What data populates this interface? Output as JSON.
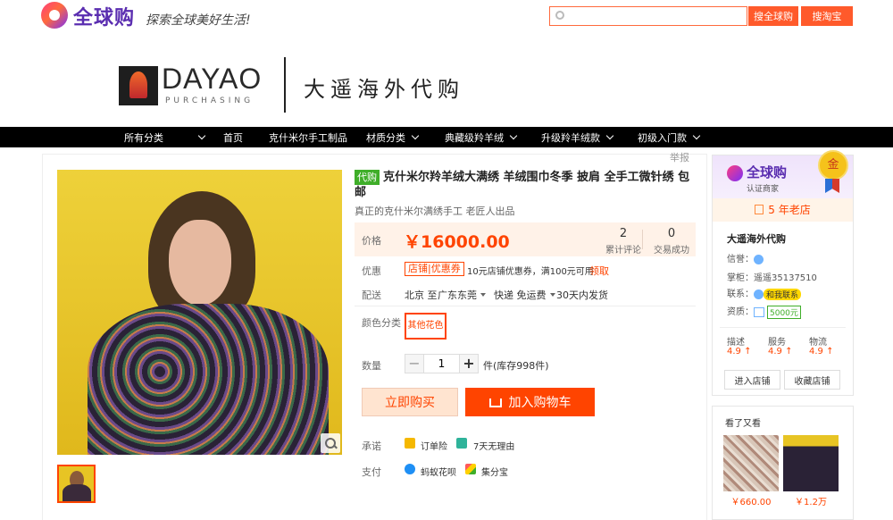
{
  "header": {
    "logo_text": "全球购",
    "slogan": "探索全球美好生活!",
    "search_placeholder": "",
    "search_global_label": "搜全球购",
    "search_taobao_label": "搜淘宝"
  },
  "brand": {
    "name": "DAYAO",
    "sub": "PURCHASING",
    "cn_name": "大遥海外代购"
  },
  "nav": {
    "items": [
      "所有分类",
      "首页",
      "克什米尔手工制品",
      "材质分类",
      "典藏级羚羊绒",
      "升级羚羊绒款",
      "初级入门款"
    ]
  },
  "product": {
    "report_label": "举报",
    "tag": "代购",
    "title": "克什米尔羚羊绒大满绣 羊绒围巾冬季 披肩 全手工微针绣 包邮",
    "subtitle": "真正的克什米尔满绣手工 老匠人出品",
    "price_label": "价格",
    "price": "￥16000.00",
    "reviews_count": "2",
    "reviews_label": "累计评论",
    "sales_count": "0",
    "sales_label": "交易成功",
    "coupon_label": "优惠",
    "coupon_tag": "店铺",
    "coupon_tag2": "优惠券",
    "coupon_text": "10元店铺优惠券，满100元可用",
    "coupon_link": "领取",
    "ship_label": "配送",
    "ship_from": "北京 至",
    "ship_to": "广东东莞",
    "ship_fee": "快递 免运费",
    "ship_time": "30天内发货",
    "color_label": "颜色分类",
    "color_option": "其他花色",
    "qty_label": "数量",
    "qty_value": "1",
    "qty_minus": "−",
    "qty_plus": "+",
    "stock": "件(库存998件)",
    "buy_now": "立即购买",
    "add_cart": "加入购物车",
    "promise_label": "承诺",
    "promise_1": "订单险",
    "promise_2": "7天无理由",
    "pay_label": "支付",
    "pay_1": "蚂蚁花呗",
    "pay_2": "集分宝"
  },
  "shop": {
    "logo_text": "全球购",
    "cert_text": "认证商家",
    "medal": "金",
    "years": "5 年老店",
    "name": "大遥海外代购",
    "credit_label": "信誉：",
    "keeper_label": "掌柜：",
    "keeper": "遥遥35137510",
    "contact_label": "联系：",
    "contact_badge": "和我联系",
    "qual_label": "资质：",
    "deposit": "5000元",
    "score_labels": [
      "描述",
      "服务",
      "物流"
    ],
    "score_values": [
      "4.9 ↑",
      "4.9 ↑",
      "4.9 ↑"
    ],
    "enter_shop": "进入店铺",
    "fav_shop": "收藏店铺"
  },
  "also_viewed": {
    "title": "看了又看",
    "prices": [
      "￥660.00",
      "￥1.2万"
    ]
  }
}
